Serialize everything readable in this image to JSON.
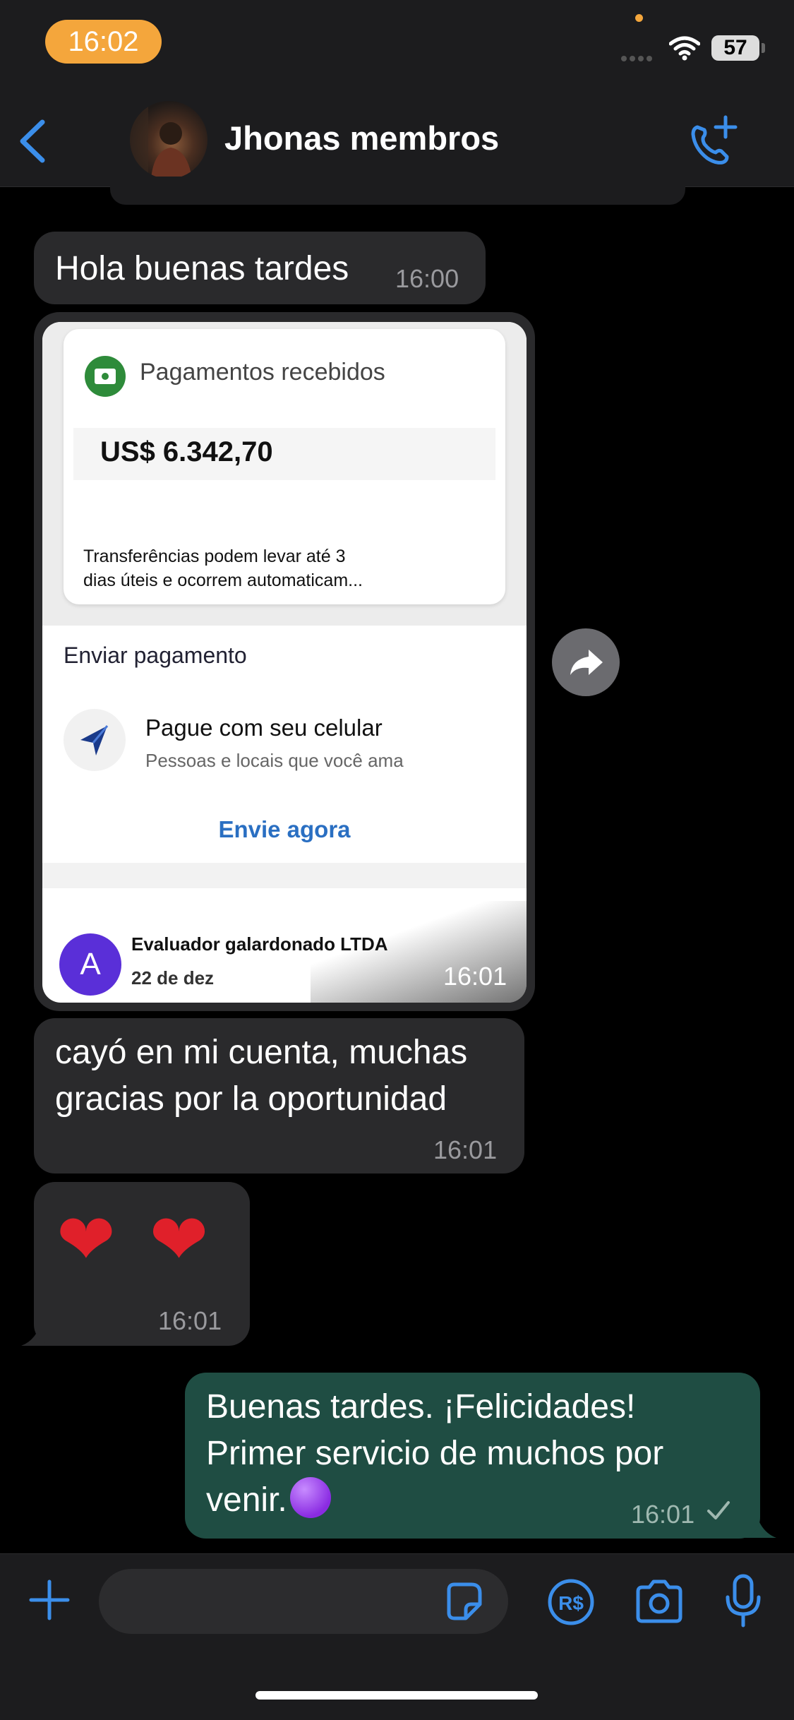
{
  "status_bar": {
    "time": "16:02",
    "battery": "57"
  },
  "header": {
    "title": "Jhonas membros",
    "back_icon": "chevron-left-icon",
    "call_icon": "add-call-icon"
  },
  "messages": [
    {
      "direction": "incoming",
      "text": "Hola buenas tardes",
      "time": "16:00"
    },
    {
      "direction": "incoming",
      "type": "image",
      "time": "16:01",
      "image": {
        "card_title": "Pagamentos recebidos",
        "amount": "US$ 6.342,70",
        "note_line1": "Transferências podem levar até 3",
        "note_line2": "dias úteis e ocorrem automaticam...",
        "send_title": "Enviar pagamento",
        "pay_title": "Pague com seu celular",
        "pay_subtitle": "Pessoas e locais que você ama",
        "pay_link": "Envie agora",
        "payee_initial": "A",
        "payee_name": "Evaluador galardonado LTDA",
        "payee_date": "22 de dez"
      }
    },
    {
      "direction": "incoming",
      "text_line1": "cayó en mi cuenta, muchas",
      "text_line2": "gracias por la oportunidad",
      "time": "16:01"
    },
    {
      "direction": "incoming",
      "text": "❤ ❤",
      "time": "16:01"
    },
    {
      "direction": "outgoing",
      "text_line1": "Buenas tardes. ¡Felicidades!",
      "text_line2": "Primer servicio de muchos por",
      "text_line3": "venir.",
      "time": "16:01",
      "status": "sent"
    }
  ],
  "input_bar": {
    "placeholder": "",
    "icons": [
      "plus-icon",
      "sticker-icon",
      "payment-icon",
      "camera-icon",
      "microphone-icon"
    ]
  },
  "colors": {
    "accent": "#3b8eea",
    "outgoing_bubble": "#1f4d43",
    "incoming_bubble": "#2a2a2c",
    "time_pill": "#f4a63c"
  }
}
